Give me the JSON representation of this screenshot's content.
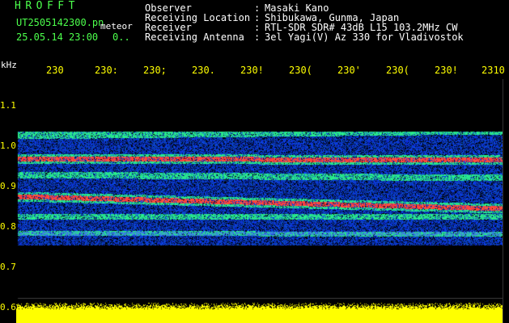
{
  "header": {
    "title": "HROFFT",
    "filename": "UT2505142300.pn",
    "kind": "meteor",
    "timestamp": "25.05.14 23:00",
    "timestamp_extra": "0..",
    "info": [
      {
        "label": "Observer",
        "value": "Masaki Kano"
      },
      {
        "label": "Receiving Location",
        "value": "Shibukawa, Gunma, Japan"
      },
      {
        "label": "Receiver",
        "value": "RTL-SDR SDR# 43dB L15 103.2MHz CW"
      },
      {
        "label": "Receiving Antenna",
        "value": "3el Yagi(V) Az 330 for Vladivostok"
      }
    ]
  },
  "axis": {
    "unit": "kHz",
    "time_ticks": [
      "230",
      "230:",
      "230;",
      "230.",
      "230!",
      "230(",
      "230'",
      "230(",
      "230!",
      "2310"
    ],
    "freq_ticks": [
      "1.1",
      "1.0",
      "0.9",
      "0.8",
      "0.7",
      "0.6"
    ]
  },
  "colors": {
    "header_green": "#4cff4c",
    "header_white": "#ffffff",
    "tick_yellow": "#ffff00",
    "noise_blue": "#1a3cc8",
    "band_green": "#2ee09a",
    "band_red": "#ff2a3c",
    "level_yellow": "#ffff00"
  }
}
